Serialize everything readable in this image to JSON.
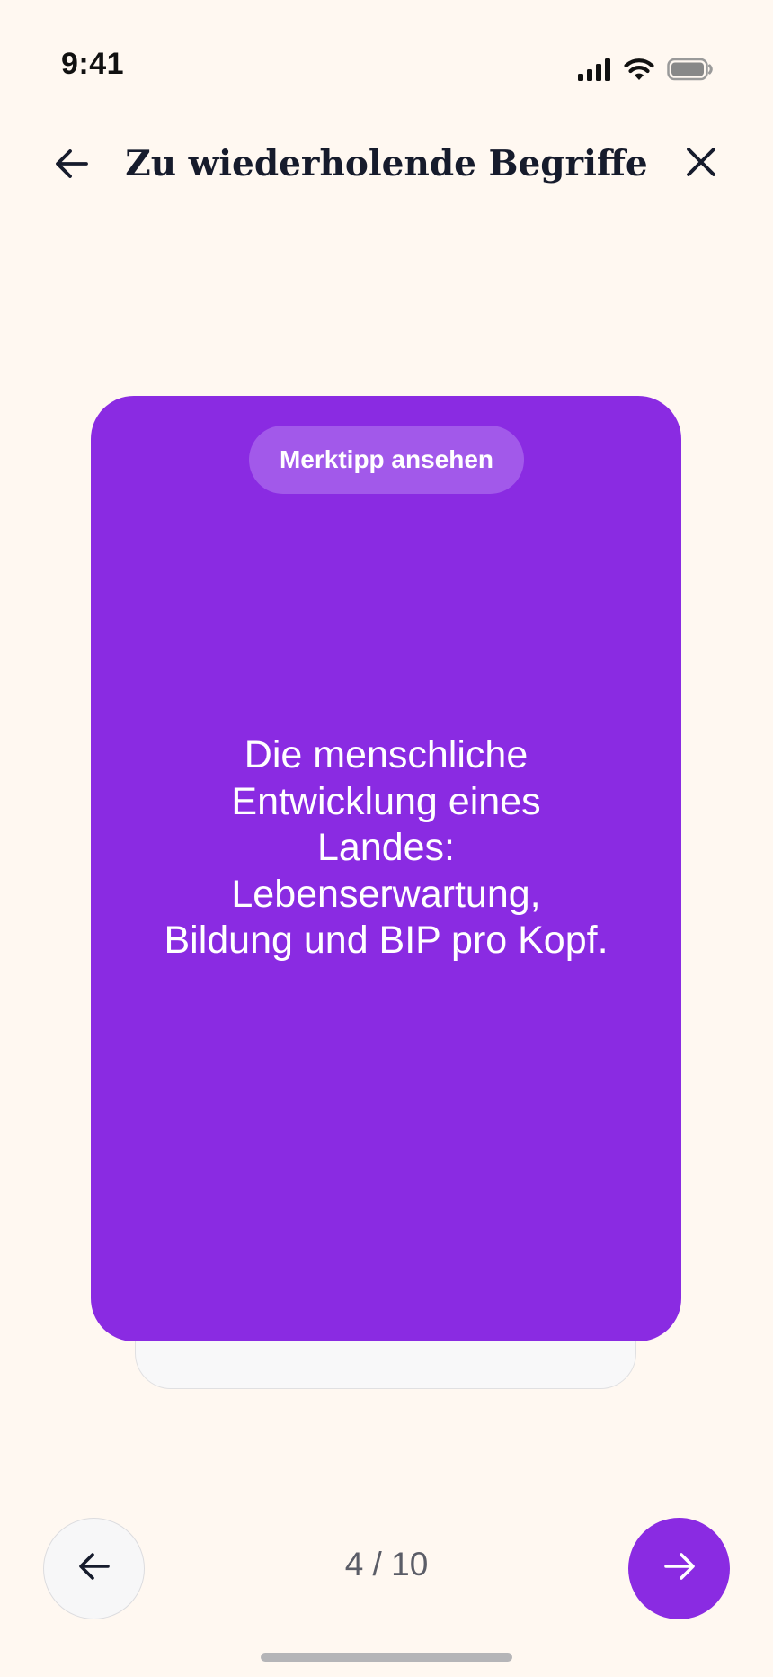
{
  "status_bar": {
    "time": "9:41"
  },
  "header": {
    "title": "Zu wiederholende Begriffe",
    "back_icon": "arrow-left-icon",
    "close_icon": "close-icon"
  },
  "card": {
    "hint_button_label": "Merktipp ansehen",
    "text": "Die menschliche Entwicklung eines Landes: Lebenserwartung, Bildung und BIP pro Kopf.",
    "color": "#8A2BE2"
  },
  "navigation": {
    "counter": "4 / 10",
    "prev_icon": "arrow-left-icon",
    "next_icon": "arrow-right-icon"
  },
  "colors": {
    "background": "#FFF8F1",
    "accent": "#8A2BE2",
    "text": "#161B2C"
  }
}
